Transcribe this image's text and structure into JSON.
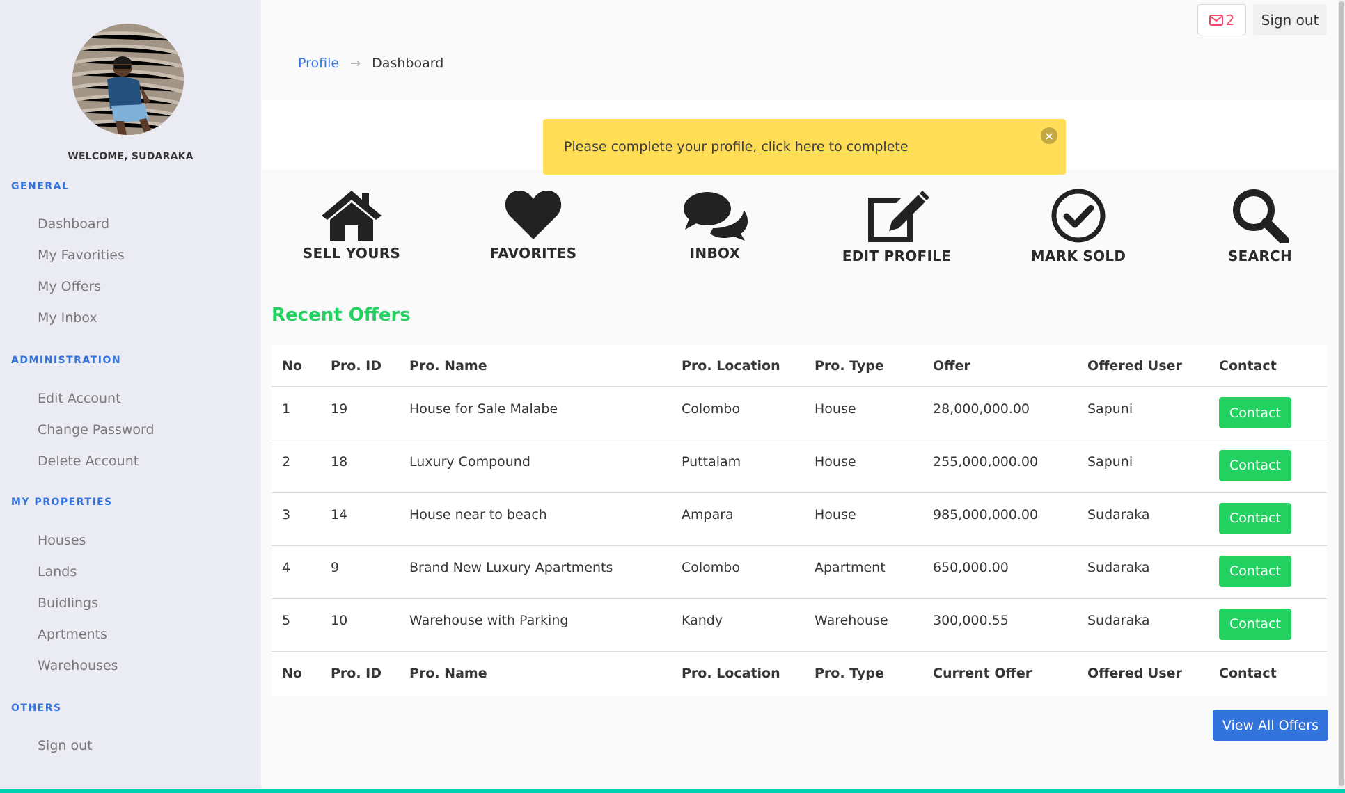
{
  "sidebar": {
    "welcome": "WELCOME, SUDARAKA",
    "sections": {
      "general": {
        "label": "GENERAL",
        "items": [
          "Dashboard",
          "My Favorities",
          "My Offers",
          "My Inbox"
        ]
      },
      "administration": {
        "label": "ADMINISTRATION",
        "items": [
          "Edit Account",
          "Change Password",
          "Delete Account"
        ]
      },
      "properties": {
        "label": "MY PROPERTIES",
        "items": [
          "Houses",
          "Lands",
          "Buidlings",
          "Aprtments",
          "Warehouses"
        ]
      },
      "others": {
        "label": "OTHERS",
        "items": [
          "Sign out"
        ]
      }
    }
  },
  "topbar": {
    "mail_count": "2",
    "signout_label": "Sign out"
  },
  "breadcrumb": {
    "link": "Profile",
    "separator": "→",
    "current": "Dashboard"
  },
  "notification": {
    "text": "Please complete your profile,",
    "link": "click here to complete"
  },
  "actions": [
    {
      "label": "SELL YOURS",
      "icon": "home-icon"
    },
    {
      "label": "FAVORITES",
      "icon": "heart-icon"
    },
    {
      "label": "INBOX",
      "icon": "comments-icon"
    },
    {
      "label": "EDIT PROFILE",
      "icon": "edit-icon"
    },
    {
      "label": "MARK SOLD",
      "icon": "check-circle-icon"
    },
    {
      "label": "SEARCH",
      "icon": "search-icon"
    }
  ],
  "recent_offers": {
    "title": "Recent Offers",
    "header": [
      "No",
      "Pro. ID",
      "Pro. Name",
      "Pro. Location",
      "Pro. Type",
      "Offer",
      "Offered User",
      "Contact"
    ],
    "footer": [
      "No",
      "Pro. ID",
      "Pro. Name",
      "Pro. Location",
      "Pro. Type",
      "Current Offer",
      "Offered User",
      "Contact"
    ],
    "rows": [
      [
        "1",
        "19",
        "House for Sale Malabe",
        "Colombo",
        "House",
        "28,000,000.00",
        "Sapuni",
        "Contact"
      ],
      [
        "2",
        "18",
        "Luxury Compound",
        "Puttalam",
        "House",
        "255,000,000.00",
        "Sapuni",
        "Contact"
      ],
      [
        "3",
        "14",
        "House near to beach",
        "Ampara",
        "House",
        "985,000,000.00",
        "Sudaraka",
        "Contact"
      ],
      [
        "4",
        "9",
        "Brand New Luxury Apartments",
        "Colombo",
        "Apartment",
        "650,000.00",
        "Sudaraka",
        "Contact"
      ],
      [
        "5",
        "10",
        "Warehouse with Parking",
        "Kandy",
        "Warehouse",
        "300,000.55",
        "Sudaraka",
        "Contact"
      ]
    ],
    "view_all": "View All Offers"
  },
  "colors": {
    "primary": "#3273dc",
    "success": "#23d160",
    "warning": "#ffdd57",
    "danger": "#f14668",
    "accent": "#00d1b2"
  }
}
